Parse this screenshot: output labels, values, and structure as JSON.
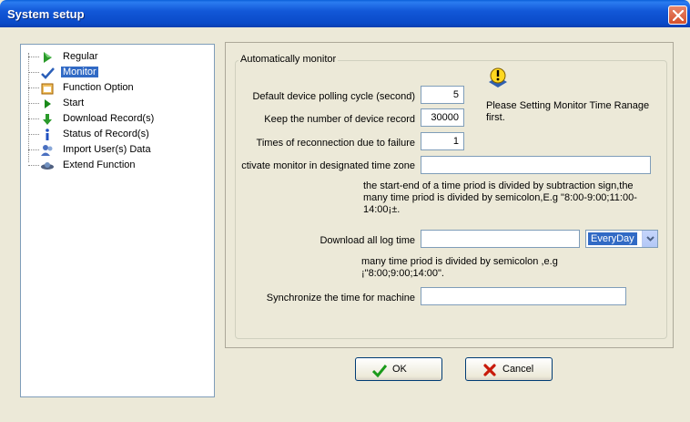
{
  "window": {
    "title": "System setup"
  },
  "tree": {
    "items": [
      {
        "label": "Regular",
        "icon": "play-arrow-icon"
      },
      {
        "label": "Monitor",
        "icon": "checkmark-icon",
        "selected": true
      },
      {
        "label": "Function Option",
        "icon": "window-icon"
      },
      {
        "label": "Start",
        "icon": "play-icon"
      },
      {
        "label": "Download Record(s)",
        "icon": "download-arrow-icon"
      },
      {
        "label": "Status of Record(s)",
        "icon": "info-icon"
      },
      {
        "label": "Import User(s) Data",
        "icon": "users-icon"
      },
      {
        "label": "Extend Function",
        "icon": "satellite-icon"
      }
    ]
  },
  "monitor": {
    "group_title": "Automatically monitor",
    "polling_label": "Default device polling cycle (second)",
    "polling_value": "5",
    "keep_label": "Keep the number of device record",
    "keep_value": "30000",
    "reconnect_label": "Times of reconnection due to failure",
    "reconnect_value": "1",
    "activate_label": "ctivate monitor in designated time zone",
    "activate_value": "",
    "activate_note": "the start-end of a time priod is divided  by subtraction sign,the many time priod is divided by semicolon,E.g \"8:00-9:00;11:00-14:00¡±.",
    "download_label": "Download all log time",
    "download_value": "",
    "download_mode": "EveryDay",
    "download_note": "many time priod is divided by semicolon ,e.g ¡\"8:00;9:00;14:00\".",
    "sync_label": "Synchronize the time for machine",
    "sync_value": "",
    "hint_text": "Please Setting Monitor Time Ranage first."
  },
  "buttons": {
    "ok": "OK",
    "cancel": "Cancel"
  }
}
